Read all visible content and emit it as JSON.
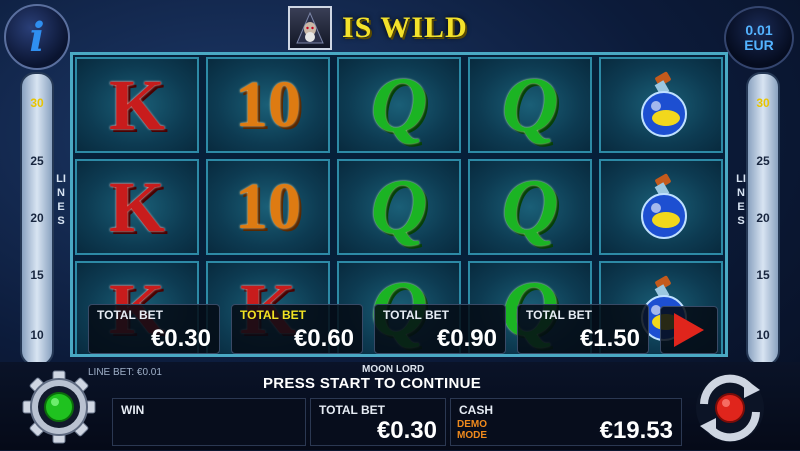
{
  "header": {
    "info_symbol": "i",
    "wild_text": "IS WILD",
    "denomination": {
      "value": "0.01",
      "currency": "EUR"
    }
  },
  "side_panel": {
    "lines_label": "LINES",
    "line_values": [
      "30",
      "25",
      "20",
      "15",
      "10"
    ],
    "active_lines": "30"
  },
  "reels": [
    [
      "K",
      "10",
      "Q",
      "Q",
      "potion"
    ],
    [
      "K",
      "10",
      "Q",
      "Q",
      "potion"
    ],
    [
      "K",
      "K",
      "Q",
      "Q",
      "potion"
    ]
  ],
  "bet_options": [
    {
      "label": "TOTAL BET",
      "value": "€0.30",
      "selected": false
    },
    {
      "label": "TOTAL BET",
      "value": "€0.60",
      "selected": true
    },
    {
      "label": "TOTAL BET",
      "value": "€0.90",
      "selected": false
    },
    {
      "label": "TOTAL BET",
      "value": "€1.50",
      "selected": false
    }
  ],
  "footer": {
    "line_bet": "LINE BET: €0.01",
    "game_name": "MOON LORD",
    "message": "PRESS START TO CONTINUE",
    "win_label": "WIN",
    "win_value": "",
    "total_bet_label": "TOTAL BET",
    "total_bet_value": "€0.30",
    "cash_label": "CASH",
    "cash_value": "€19.53",
    "demo_mode": "DEMO MODE"
  },
  "icons": {
    "settings": "gear-icon",
    "spin": "spin-arrows-icon",
    "play": "play-icon",
    "wild_symbol": "wizard-icon"
  },
  "colors": {
    "accent_yellow": "#f4e22b",
    "reel_border": "#4aa9c4",
    "spin_red": "#e0251c",
    "status_green": "#1fc21f"
  }
}
